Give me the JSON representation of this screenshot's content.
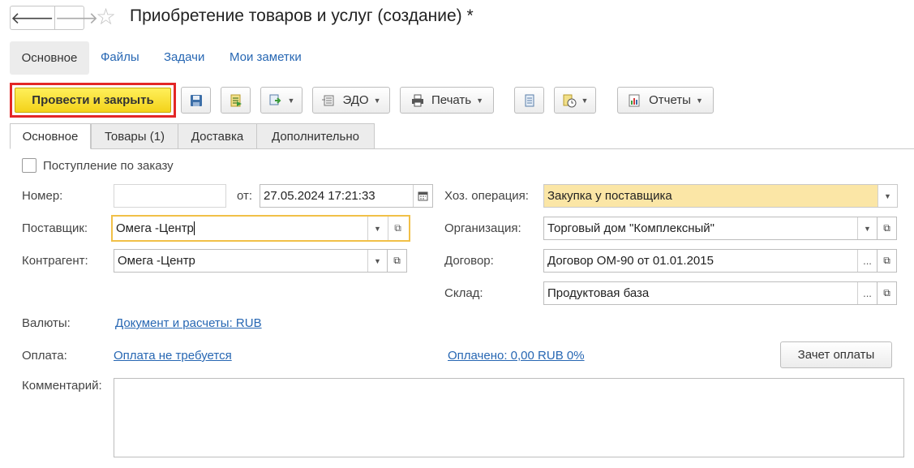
{
  "header": {
    "back_icon": "arrow-left-icon",
    "forward_icon": "arrow-right-icon",
    "favorite_icon": "star-icon",
    "title": "Приобретение товаров и услуг (создание) *"
  },
  "sections": {
    "active": "Основное",
    "links": [
      "Файлы",
      "Задачи",
      "Мои заметки"
    ]
  },
  "toolbar": {
    "post_close_label": "Провести и закрыть",
    "edo_label": "ЭДО",
    "print_label": "Печать",
    "reports_label": "Отчеты",
    "primary_color": "#f5d51e",
    "highlight_color": "#e32626"
  },
  "tabs": [
    "Основное",
    "Товары (1)",
    "Доставка",
    "Дополнительно"
  ],
  "form": {
    "by_order_label": "Поступление по заказу",
    "number_label": "Номер:",
    "number_value": "",
    "date_prefix": "от:",
    "date_value": "27.05.2024 17:21:33",
    "operation_label": "Хоз. операция:",
    "operation_value": "Закупка у поставщика",
    "supplier_label": "Поставщик:",
    "supplier_value": "Омега -Центр",
    "organization_label": "Организация:",
    "organization_value": "Торговый дом \"Комплексный\"",
    "counterparty_label": "Контрагент:",
    "counterparty_value": "Омега -Центр",
    "contract_label": "Договор:",
    "contract_value": "Договор ОМ-90 от 01.01.2015",
    "warehouse_label": "Склад:",
    "warehouse_value": "Продуктовая база",
    "currency_label": "Валюты:",
    "currency_link": "Документ и расчеты: RUB",
    "payment_label": "Оплата:",
    "payment_link": "Оплата не требуется",
    "paid_link": "Оплачено: 0,00 RUB 0%",
    "offset_button": "Зачет оплаты",
    "comment_label": "Комментарий:",
    "comment_value": "",
    "ellipsis": "..."
  }
}
